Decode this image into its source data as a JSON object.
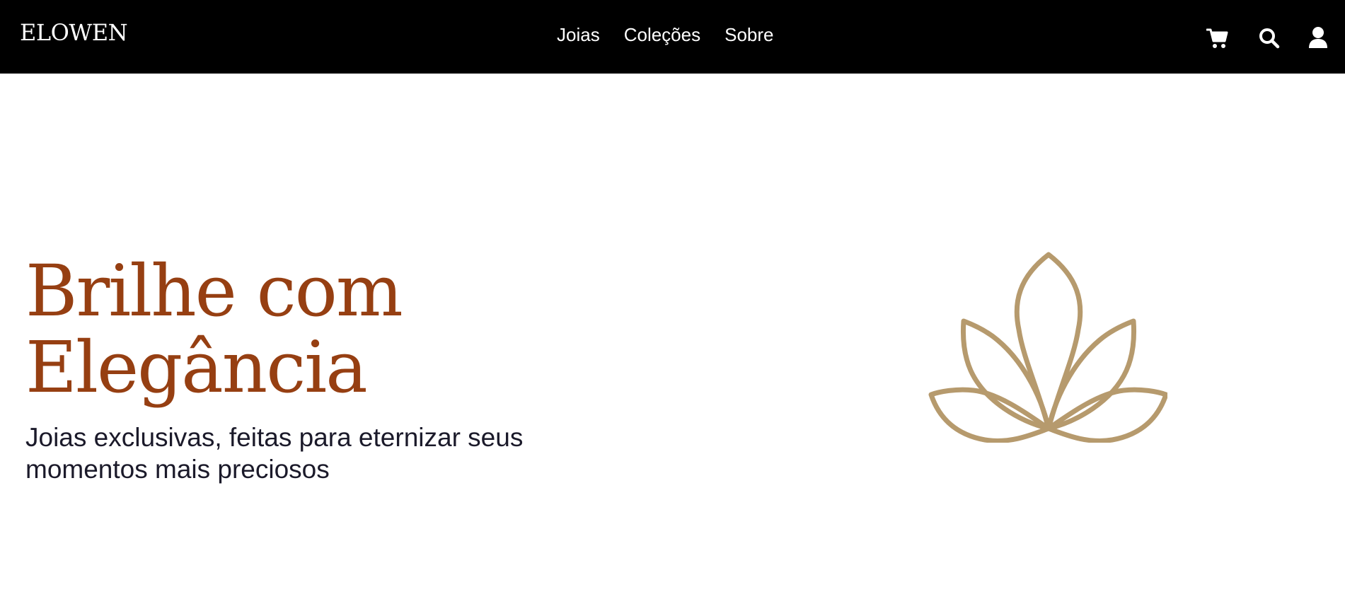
{
  "header": {
    "brand": "ELOWEN",
    "nav": [
      {
        "label": "Joias"
      },
      {
        "label": "Coleções"
      },
      {
        "label": "Sobre"
      }
    ],
    "icons": [
      "cart-icon",
      "search-icon",
      "user-icon"
    ]
  },
  "hero": {
    "title_line1": "Brilhe com",
    "title_line2": "Elegância",
    "subtitle_line1": "Joias exclusivas, feitas para eternizar seus",
    "subtitle_line2": "momentos mais preciosos",
    "logo_icon": "lotus-icon"
  },
  "colors": {
    "header_bg": "#000000",
    "header_text": "#ffffff",
    "title": "#963f12",
    "subtitle": "#1b1a2a",
    "lotus": "#b69a6d",
    "page_bg": "#ffffff"
  }
}
